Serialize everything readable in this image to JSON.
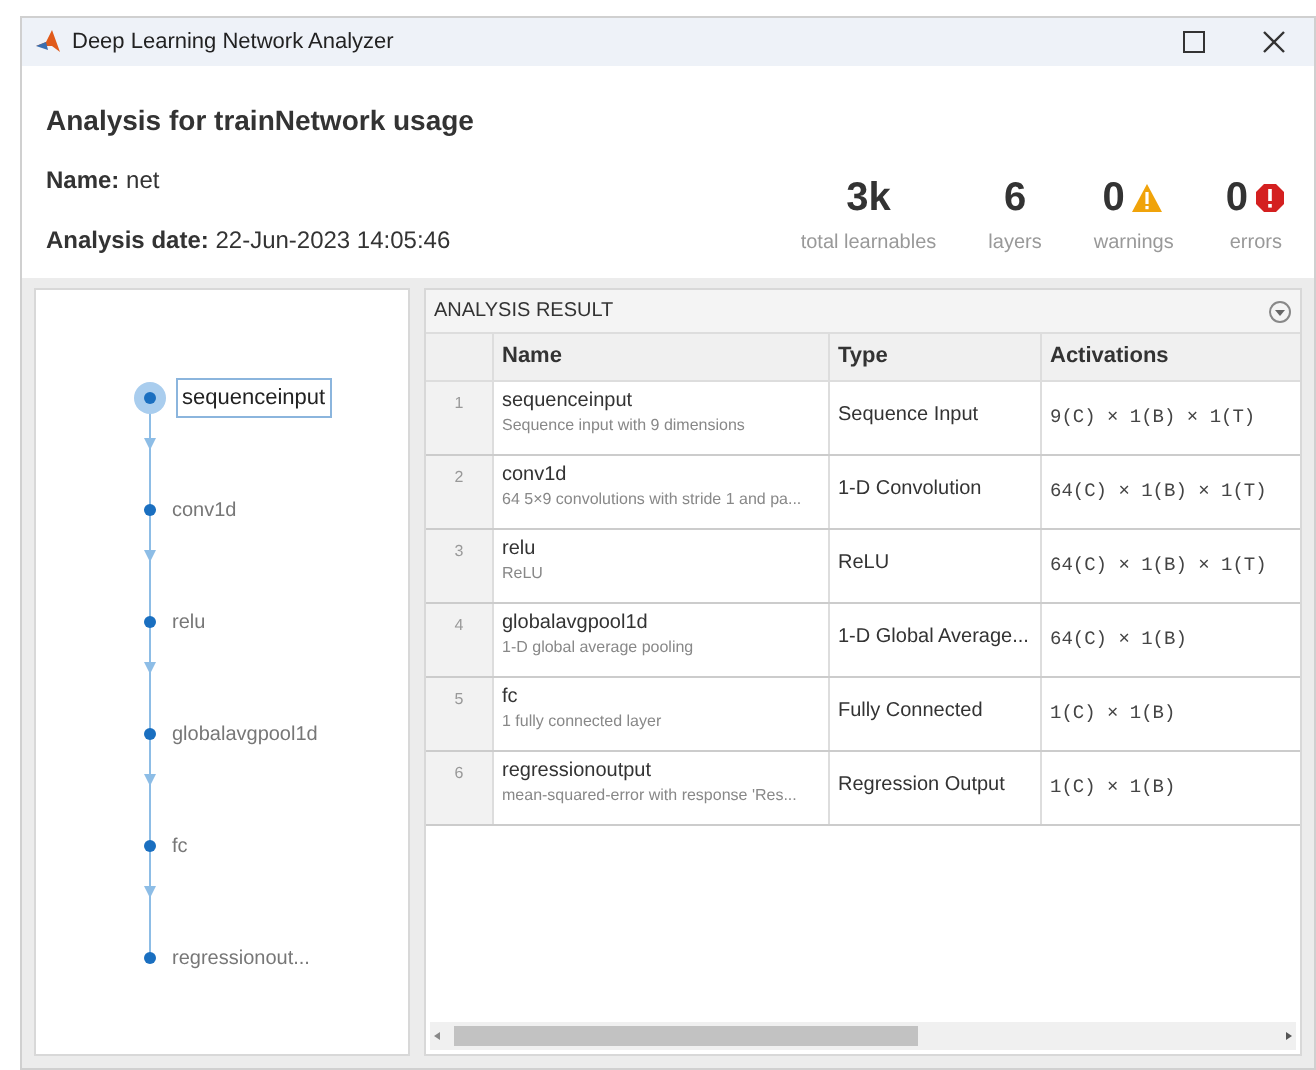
{
  "window": {
    "title": "Deep Learning Network Analyzer"
  },
  "header": {
    "title": "Analysis for trainNetwork usage",
    "name_label": "Name:",
    "name_value": "net",
    "date_label": "Analysis date:",
    "date_value": "22-Jun-2023 14:05:46",
    "stats": [
      {
        "kind": "plain",
        "value": "3k",
        "label": "total learnables"
      },
      {
        "kind": "plain",
        "value": "6",
        "label": "layers"
      },
      {
        "kind": "warning",
        "value": "0",
        "label": "warnings"
      },
      {
        "kind": "error",
        "value": "0",
        "label": "errors"
      }
    ]
  },
  "graph": {
    "nodes": [
      {
        "label": "sequenceinput",
        "selected": true
      },
      {
        "label": "conv1d",
        "selected": false
      },
      {
        "label": "relu",
        "selected": false
      },
      {
        "label": "globalavgpool1d",
        "selected": false
      },
      {
        "label": "fc",
        "selected": false
      },
      {
        "label": "regressionout...",
        "selected": false
      }
    ]
  },
  "table": {
    "title": "ANALYSIS RESULT",
    "columns": [
      "Name",
      "Type",
      "Activations"
    ],
    "rows": [
      {
        "index": "1",
        "name": "sequenceinput",
        "description": "Sequence input with 9 dimensions",
        "type": "Sequence Input",
        "activations": "9(C) × 1(B) × 1(T)"
      },
      {
        "index": "2",
        "name": "conv1d",
        "description": "64 5×9 convolutions with stride 1 and pa...",
        "type": "1-D Convolution",
        "activations": "64(C) × 1(B) × 1(T)"
      },
      {
        "index": "3",
        "name": "relu",
        "description": "ReLU",
        "type": "ReLU",
        "activations": "64(C) × 1(B) × 1(T)"
      },
      {
        "index": "4",
        "name": "globalavgpool1d",
        "description": "1-D global average pooling",
        "type": "1-D Global Average...",
        "activations": "64(C) × 1(B)"
      },
      {
        "index": "5",
        "name": "fc",
        "description": "1 fully connected layer",
        "type": "Fully Connected",
        "activations": "1(C) × 1(B)"
      },
      {
        "index": "6",
        "name": "regressionoutput",
        "description": "mean-squared-error with response 'Res...",
        "type": "Regression Output",
        "activations": "1(C) × 1(B)"
      }
    ]
  }
}
